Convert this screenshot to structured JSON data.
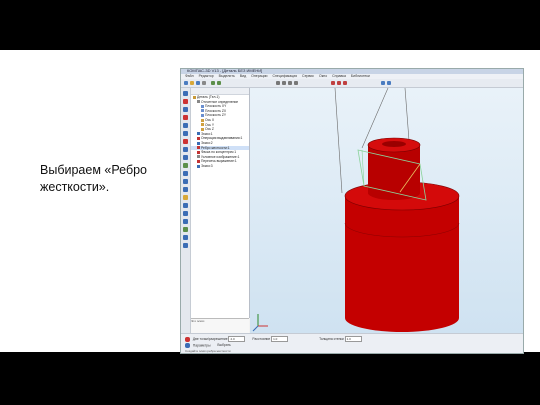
{
  "caption": "Выбираем «Ребро жесткости».",
  "app": {
    "title": "КОМПАС-3D V13 - [Деталь БЕЗ ИМЕНИ]",
    "menu": [
      "Файл",
      "Редактор",
      "Выделить",
      "Вид",
      "Операции",
      "Спецификация",
      "Сервис",
      "Окно",
      "Справка",
      "Библиотеки"
    ],
    "tree": {
      "items": [
        {
          "label": "Деталь (Тел-1)",
          "depth": 0,
          "color": "#c89a3a"
        },
        {
          "label": "Отсчетное определение",
          "depth": 1,
          "color": "#888888"
        },
        {
          "label": "Плоскость XY",
          "depth": 2,
          "color": "#6a8fcf"
        },
        {
          "label": "Плоскость ZX",
          "depth": 2,
          "color": "#6a8fcf"
        },
        {
          "label": "Плоскость ZY",
          "depth": 2,
          "color": "#6a8fcf"
        },
        {
          "label": "Ось X",
          "depth": 2,
          "color": "#cfa040"
        },
        {
          "label": "Ось Y",
          "depth": 2,
          "color": "#cfa040"
        },
        {
          "label": "Ось Z",
          "depth": 2,
          "color": "#cfa040"
        },
        {
          "label": "Эскиз:1",
          "depth": 1,
          "color": "#3b6db5"
        },
        {
          "label": "Операция выдавливания:1",
          "depth": 1,
          "color": "#c33333"
        },
        {
          "label": "Эскиз:2",
          "depth": 1,
          "color": "#3b6db5"
        },
        {
          "label": "Ребро жесткости:1",
          "depth": 1,
          "color": "#c33333"
        },
        {
          "label": "Фаска по концентрич:1",
          "depth": 1,
          "color": "#c33333"
        },
        {
          "label": "Условное изображение:1",
          "depth": 1,
          "color": "#888888"
        },
        {
          "label": "Пересечь выражение:1",
          "depth": 1,
          "color": "#c33333"
        },
        {
          "label": "Эскиз:3",
          "depth": 1,
          "color": "#3b6db5"
        }
      ],
      "selected_index": 11,
      "footer": "Это эскиз"
    },
    "status": {
      "row1_label": "Две точки/разрешение",
      "field1": "2.0",
      "row1_label2": "Расстояние",
      "field2": "1.0",
      "row1_label3": "Толщина стенки",
      "field3": "1.0",
      "row2_label": "Параметры",
      "row2_label2": "Выбрать",
      "hint": "Создайте эскиз ребра жесткости"
    },
    "colors": {
      "part": "#c40000",
      "part_dark": "#8a0000",
      "sketch": "#8bd39b",
      "accent": "#3b6db5"
    }
  }
}
